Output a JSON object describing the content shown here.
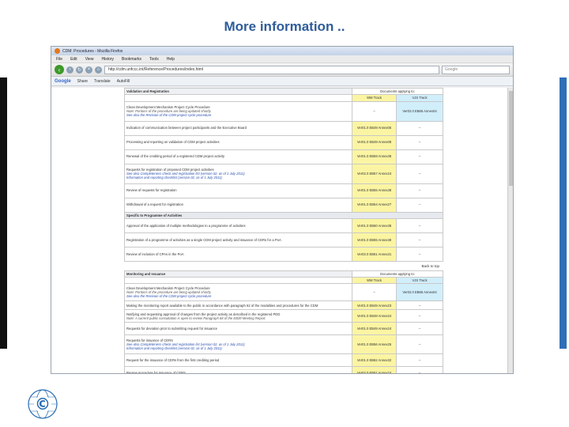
{
  "slide": {
    "title": "More information .."
  },
  "browser": {
    "window_title": "CDM: Procedures - Mozilla Firefox",
    "menu": [
      "File",
      "Edit",
      "View",
      "History",
      "Bookmarks",
      "Tools",
      "Help"
    ],
    "url": "http://cdm.unfccc.int/Reference/Procedures/index.html",
    "search_placeholder": "Google",
    "google_bar": [
      "Google",
      "Share",
      "Translate",
      "AutoFill"
    ]
  },
  "validation": {
    "section_title": "Validation and Registration",
    "docs_applying": "Documents applying to:",
    "wm_track": "WM Track",
    "vjs_track": "VJS Track",
    "rows": [
      {
        "text": "Clean Development Mechanism Project Cycle Procedure",
        "note": "Note: Portions of the procedure are being updated shortly.",
        "link": "See also the Revision of the CDM project cycle procedure",
        "v1": "--",
        "v2": "Ver02.0 EB65 Annex04"
      },
      {
        "text": "Indication of communication between project participants and the Executive Board",
        "v1": "Ver01.0 EB49 Annex05",
        "v2": "--"
      },
      {
        "text": "Processing and reporting on validation of CDM project activities",
        "v1": "Ver01.0 EB49 Annex08",
        "v2": "--"
      },
      {
        "text": "Renewal of the crediting period of a registered CDM project activity",
        "v1": "Ver01.0 EB59 Annex38",
        "v2": "--"
      },
      {
        "text": "Requests for registration of proposed CDM project activities",
        "link": "See also Completeness check and registration list (version 02, as of 1 July 2011)",
        "link2": "Information and reporting checklist (version 02, as of 1 July 2011)",
        "v1": "Ver02.0 EB57 Annex24",
        "v2": "--"
      },
      {
        "text": "Review of requests for registration",
        "v1": "Ver01.0 EB55 Annex38",
        "v2": "--"
      },
      {
        "text": "Withdrawal of a request for registration",
        "v1": "Ver01.0 EB54 Annex27",
        "v2": "--"
      }
    ]
  },
  "poa": {
    "section_title": "Specific to Programme of Activities",
    "rows": [
      {
        "text": "Approval of the application of multiple methodologies to a programme of activities",
        "v1": "Ver01.0 EB60 Annex38",
        "v2": "--"
      },
      {
        "text": "Registration of a programme of activities as a single CDM project activity and issuance of CERs for a PoA",
        "v1": "Ver01.0 EB55 Annex38",
        "v2": "--"
      },
      {
        "text": "Review of inclusion of CPAs in the PoA",
        "v1": "Ver02.0 EB61 Annex31",
        "v2": "--"
      }
    ]
  },
  "back_to_top": "Back to top",
  "monitoring": {
    "section_title": "Monitoring and Issuance",
    "docs_applying": "Documents applying to:",
    "wm_track": "WM Track",
    "vjs_track": "VJS Track",
    "rows": [
      {
        "text": "Clean Development Mechanism Project Cycle Procedure",
        "note": "Note: Portions of the procedure are being updated shortly.",
        "link": "See also the Revision of the CDM project cycle procedure",
        "v1": "--",
        "v2": "Ver02.0 EB65 Annex04"
      },
      {
        "text": "Making the monitoring report available to the public in accordance with paragraph 62 of the modalities and procedures for the CDM",
        "v1": "Ver01.0 EB49 Annex23",
        "v2": "--"
      },
      {
        "text": "Notifying and requesting approval of changes from the project activity as described in the registered PDD",
        "note": "Note: A current public consultation is open to review Paragraph 68 of the EB39 Meeting Report.",
        "v1": "Ver01.0 EB48 Annex24",
        "v2": "--"
      },
      {
        "text": "Requests for deviation prior to submitting request for issuance",
        "v1": "Ver01.0 EB49 Annex24",
        "v2": "--"
      },
      {
        "text": "Requests for issuance of CERS",
        "link": "See also Completeness check and registration list (version 02, as of 1 July 2011)",
        "link2": "Information and reporting checklist (version 02, as of 1 July 2011)",
        "v1": "Ver01.0 EB56 Annex25",
        "v2": "--"
      },
      {
        "text": "Request for the issuance of CERs from the first crediting period",
        "v1": "Ver01.0 EB62 Annex32",
        "v2": "--"
      },
      {
        "text": "Review procedure for issuance of CERS",
        "v1": "Ver02.0 EB61 Annex24",
        "v2": "--"
      }
    ]
  },
  "colors": {
    "title": "#2f5c9a",
    "accent_bar": "#2e6fb7",
    "wm_cell": "#fbf5a3",
    "vjs_cell": "#d1eefb"
  },
  "logo": {
    "name": "UNFCCC",
    "glyph": "©"
  }
}
